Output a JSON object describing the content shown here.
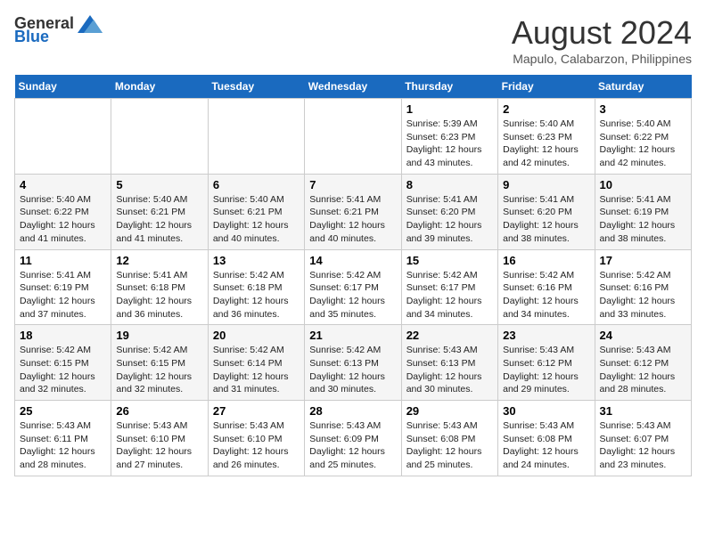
{
  "header": {
    "logo_general": "General",
    "logo_blue": "Blue",
    "month_year": "August 2024",
    "location": "Mapulo, Calabarzon, Philippines"
  },
  "days_of_week": [
    "Sunday",
    "Monday",
    "Tuesday",
    "Wednesday",
    "Thursday",
    "Friday",
    "Saturday"
  ],
  "weeks": [
    [
      {
        "day": "",
        "info": ""
      },
      {
        "day": "",
        "info": ""
      },
      {
        "day": "",
        "info": ""
      },
      {
        "day": "",
        "info": ""
      },
      {
        "day": "1",
        "info": "Sunrise: 5:39 AM\nSunset: 6:23 PM\nDaylight: 12 hours\nand 43 minutes."
      },
      {
        "day": "2",
        "info": "Sunrise: 5:40 AM\nSunset: 6:23 PM\nDaylight: 12 hours\nand 42 minutes."
      },
      {
        "day": "3",
        "info": "Sunrise: 5:40 AM\nSunset: 6:22 PM\nDaylight: 12 hours\nand 42 minutes."
      }
    ],
    [
      {
        "day": "4",
        "info": "Sunrise: 5:40 AM\nSunset: 6:22 PM\nDaylight: 12 hours\nand 41 minutes."
      },
      {
        "day": "5",
        "info": "Sunrise: 5:40 AM\nSunset: 6:21 PM\nDaylight: 12 hours\nand 41 minutes."
      },
      {
        "day": "6",
        "info": "Sunrise: 5:40 AM\nSunset: 6:21 PM\nDaylight: 12 hours\nand 40 minutes."
      },
      {
        "day": "7",
        "info": "Sunrise: 5:41 AM\nSunset: 6:21 PM\nDaylight: 12 hours\nand 40 minutes."
      },
      {
        "day": "8",
        "info": "Sunrise: 5:41 AM\nSunset: 6:20 PM\nDaylight: 12 hours\nand 39 minutes."
      },
      {
        "day": "9",
        "info": "Sunrise: 5:41 AM\nSunset: 6:20 PM\nDaylight: 12 hours\nand 38 minutes."
      },
      {
        "day": "10",
        "info": "Sunrise: 5:41 AM\nSunset: 6:19 PM\nDaylight: 12 hours\nand 38 minutes."
      }
    ],
    [
      {
        "day": "11",
        "info": "Sunrise: 5:41 AM\nSunset: 6:19 PM\nDaylight: 12 hours\nand 37 minutes."
      },
      {
        "day": "12",
        "info": "Sunrise: 5:41 AM\nSunset: 6:18 PM\nDaylight: 12 hours\nand 36 minutes."
      },
      {
        "day": "13",
        "info": "Sunrise: 5:42 AM\nSunset: 6:18 PM\nDaylight: 12 hours\nand 36 minutes."
      },
      {
        "day": "14",
        "info": "Sunrise: 5:42 AM\nSunset: 6:17 PM\nDaylight: 12 hours\nand 35 minutes."
      },
      {
        "day": "15",
        "info": "Sunrise: 5:42 AM\nSunset: 6:17 PM\nDaylight: 12 hours\nand 34 minutes."
      },
      {
        "day": "16",
        "info": "Sunrise: 5:42 AM\nSunset: 6:16 PM\nDaylight: 12 hours\nand 34 minutes."
      },
      {
        "day": "17",
        "info": "Sunrise: 5:42 AM\nSunset: 6:16 PM\nDaylight: 12 hours\nand 33 minutes."
      }
    ],
    [
      {
        "day": "18",
        "info": "Sunrise: 5:42 AM\nSunset: 6:15 PM\nDaylight: 12 hours\nand 32 minutes."
      },
      {
        "day": "19",
        "info": "Sunrise: 5:42 AM\nSunset: 6:15 PM\nDaylight: 12 hours\nand 32 minutes."
      },
      {
        "day": "20",
        "info": "Sunrise: 5:42 AM\nSunset: 6:14 PM\nDaylight: 12 hours\nand 31 minutes."
      },
      {
        "day": "21",
        "info": "Sunrise: 5:42 AM\nSunset: 6:13 PM\nDaylight: 12 hours\nand 30 minutes."
      },
      {
        "day": "22",
        "info": "Sunrise: 5:43 AM\nSunset: 6:13 PM\nDaylight: 12 hours\nand 30 minutes."
      },
      {
        "day": "23",
        "info": "Sunrise: 5:43 AM\nSunset: 6:12 PM\nDaylight: 12 hours\nand 29 minutes."
      },
      {
        "day": "24",
        "info": "Sunrise: 5:43 AM\nSunset: 6:12 PM\nDaylight: 12 hours\nand 28 minutes."
      }
    ],
    [
      {
        "day": "25",
        "info": "Sunrise: 5:43 AM\nSunset: 6:11 PM\nDaylight: 12 hours\nand 28 minutes."
      },
      {
        "day": "26",
        "info": "Sunrise: 5:43 AM\nSunset: 6:10 PM\nDaylight: 12 hours\nand 27 minutes."
      },
      {
        "day": "27",
        "info": "Sunrise: 5:43 AM\nSunset: 6:10 PM\nDaylight: 12 hours\nand 26 minutes."
      },
      {
        "day": "28",
        "info": "Sunrise: 5:43 AM\nSunset: 6:09 PM\nDaylight: 12 hours\nand 25 minutes."
      },
      {
        "day": "29",
        "info": "Sunrise: 5:43 AM\nSunset: 6:08 PM\nDaylight: 12 hours\nand 25 minutes."
      },
      {
        "day": "30",
        "info": "Sunrise: 5:43 AM\nSunset: 6:08 PM\nDaylight: 12 hours\nand 24 minutes."
      },
      {
        "day": "31",
        "info": "Sunrise: 5:43 AM\nSunset: 6:07 PM\nDaylight: 12 hours\nand 23 minutes."
      }
    ]
  ]
}
